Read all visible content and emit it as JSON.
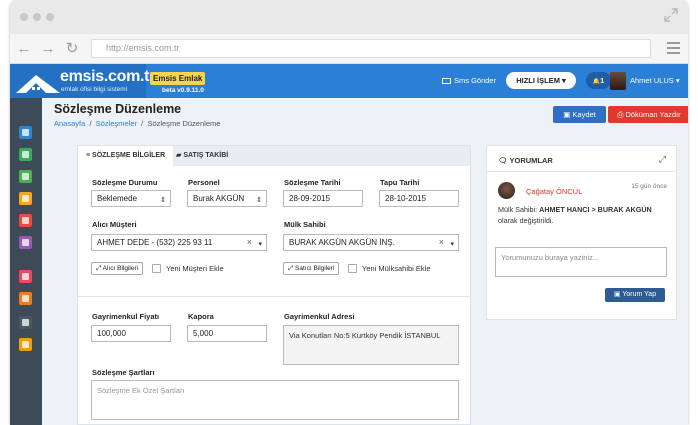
{
  "browser": {
    "url": "http://emsis.com.tr"
  },
  "header": {
    "logo_text": "emsis.com.tr",
    "logo_sub": "emlak ofisi bilgi sistemi",
    "brand_badge": "Emsis Emlak",
    "version": "beta v0.9.11.0",
    "sms_label": "Sms Gönder",
    "quick_label": "HIZLI İŞLEM",
    "notif_count": "1",
    "user_name": "Ahmet ULUS"
  },
  "sidebar": {
    "items": [
      {
        "icon": "dashboard-icon",
        "color": "#2e86d0"
      },
      {
        "icon": "grid-icon",
        "color": "#3aaa5c"
      },
      {
        "icon": "edit-icon",
        "color": "#4caf50"
      },
      {
        "icon": "folder-icon",
        "color": "#f5a623"
      },
      {
        "icon": "thumbs-up-icon",
        "color": "#e74c3c"
      },
      {
        "icon": "user-icon",
        "color": "#9b59b6"
      },
      {
        "icon": "document-icon",
        "color": "#e84a5f"
      },
      {
        "icon": "money-icon",
        "color": "#e67e22"
      },
      {
        "icon": "chart-icon",
        "color": "#3d4a57"
      },
      {
        "icon": "list-icon",
        "color": "#f39c12"
      }
    ]
  },
  "page": {
    "title": "Sözleşme Düzenleme",
    "breadcrumb": [
      "Anasayfa",
      "Sözleşmeler",
      "Sözleşme Düzenleme"
    ],
    "save_label": "Kaydet",
    "print_label": "Döküman Yazdır"
  },
  "tabs": [
    {
      "label": "SÖZLEŞME BİLGİLER",
      "active": true
    },
    {
      "label": "SATIŞ TAKİBİ",
      "active": false
    }
  ],
  "form": {
    "status_label": "Sözleşme Durumu",
    "status_value": "Beklemede",
    "staff_label": "Personel",
    "staff_value": "Burak AKGÜN",
    "contract_date_label": "Sözleşme Tarihi",
    "contract_date_value": "28-09-2015",
    "deed_date_label": "Tapu Tarihi",
    "deed_date_value": "28-10-2015",
    "buyer_label": "Alıcı Müşteri",
    "buyer_value": "AHMET DEDE - (532) 225 93 11",
    "owner_label": "Mülk Sahibi",
    "owner_value": "BURAK AKGÜN AKGÜN İNŞ.",
    "buyer_info_btn": "Alıcı Bilgileri",
    "new_customer_label": "Yeni Müşteri Ekle",
    "seller_info_btn": "Satıcı Bilgileri",
    "new_owner_label": "Yeni Mülksahibi Ekle",
    "price_label": "Gayrimenkul Fiyatı",
    "price_value": "100,000",
    "deposit_label": "Kapora",
    "deposit_value": "5,000",
    "address_label": "Gayrimenkul Adresi",
    "address_value": "Via Konutları No:5 Kurtköy Pendik İSTANBUL",
    "terms_label": "Sözleşme Şartları",
    "terms_placeholder": "Sözleşme Ek Özel Şartları"
  },
  "comments": {
    "title": "YORUMLAR",
    "author": "Çağatay ÖNCÜL",
    "time": "15 gün önce",
    "text_prefix": "Mülk Sahibi:",
    "text_from": "AHMET HANCI",
    "text_arrow": ">",
    "text_to": "BURAK AKGÜN",
    "text_suffix": "olarak değiştirildi.",
    "input_placeholder": "Yorumunuzu buraya yaziniz...",
    "submit_label": "Yorum Yap"
  }
}
